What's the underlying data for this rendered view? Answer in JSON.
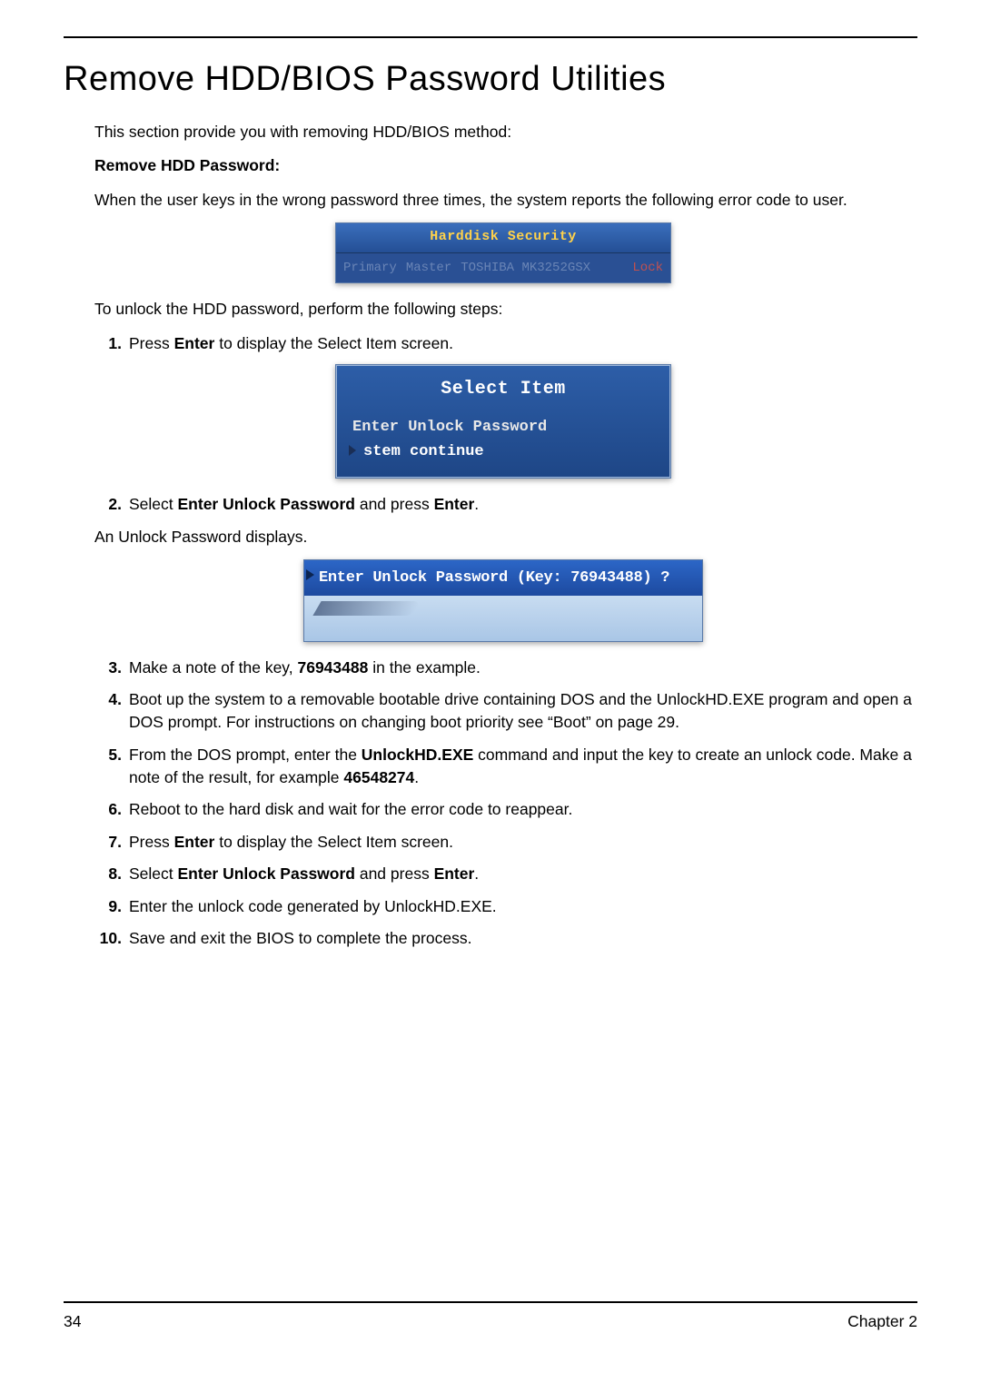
{
  "title": "Remove HDD/BIOS Password Utilities",
  "intro": "This section provide you with removing HDD/BIOS method:",
  "subhead": "Remove HDD Password:",
  "para1": "When the user keys in the wrong password three times, the system reports the following error code to user.",
  "fig1": {
    "header": "Harddisk Security",
    "col1": "Primary",
    "col2": "Master",
    "col3": "TOSHIBA MK3252GSX",
    "col4": "Lock"
  },
  "para2": "To unlock the HDD password, perform the following steps:",
  "steps": {
    "s1_pre": "Press ",
    "s1_b": "Enter",
    "s1_post": " to display the Select Item screen.",
    "s2_pre": "Select ",
    "s2_b1": "Enter Unlock Password",
    "s2_mid": " and press ",
    "s2_b2": "Enter",
    "s2_post": ".",
    "s3_pre": "Make a note of the key, ",
    "s3_b": "76943488",
    "s3_post": " in the example.",
    "s4": "Boot up the system to a removable bootable drive containing DOS and the UnlockHD.EXE program and open a DOS prompt. For instructions on changing boot priority see “Boot” on page 29.",
    "s5_pre": "From the DOS prompt, enter the ",
    "s5_b1": "UnlockHD.EXE",
    "s5_mid": " command and input the key to create an unlock code. Make a note of the result, for example ",
    "s5_b2": "46548274",
    "s5_post": ".",
    "s6": "Reboot to the hard disk and wait for the error code to reappear.",
    "s7_pre": "Press ",
    "s7_b": "Enter",
    "s7_post": " to display the Select Item screen.",
    "s8_pre": "Select ",
    "s8_b1": "Enter Unlock Password",
    "s8_mid": " and press ",
    "s8_b2": "Enter",
    "s8_post": ".",
    "s9": "Enter the unlock code generated by UnlockHD.EXE.",
    "s10": "Save and exit the BIOS to complete the process."
  },
  "fig2": {
    "title": "Select Item",
    "opt1": "Enter Unlock Password",
    "opt2": "stem continue"
  },
  "para3": "An Unlock Password displays.",
  "fig3": {
    "line": "Enter Unlock  Password (Key: 76943488) ?"
  },
  "footer": {
    "page": "34",
    "chapter": "Chapter 2"
  },
  "nums": {
    "n1": "1.",
    "n2": "2.",
    "n3": "3.",
    "n4": "4.",
    "n5": "5.",
    "n6": "6.",
    "n7": "7.",
    "n8": "8.",
    "n9": "9.",
    "n10": "10."
  }
}
